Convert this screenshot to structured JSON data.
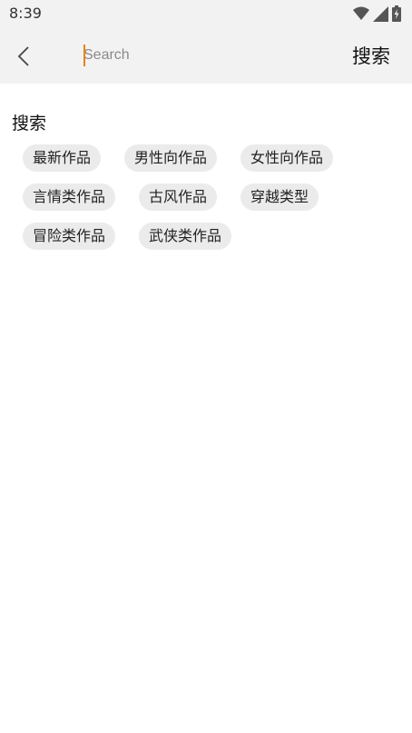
{
  "status_bar": {
    "time": "8:39",
    "icons": [
      "wifi-icon",
      "signal-icon",
      "battery-icon"
    ]
  },
  "header": {
    "back_icon": "chevron-left-icon",
    "search_placeholder": "Search",
    "search_value": "",
    "search_button_label": "搜索"
  },
  "section": {
    "title": "搜索"
  },
  "tags": [
    [
      "最新作品",
      "男性向作品",
      "女性向作品"
    ],
    [
      "言情类作品",
      "古风作品",
      "穿越类型"
    ],
    [
      "冒险类作品",
      "武侠类作品"
    ]
  ],
  "colors": {
    "header_bg": "#f2f2f2",
    "tag_bg": "#ebebeb",
    "cursor": "#e8830a"
  }
}
